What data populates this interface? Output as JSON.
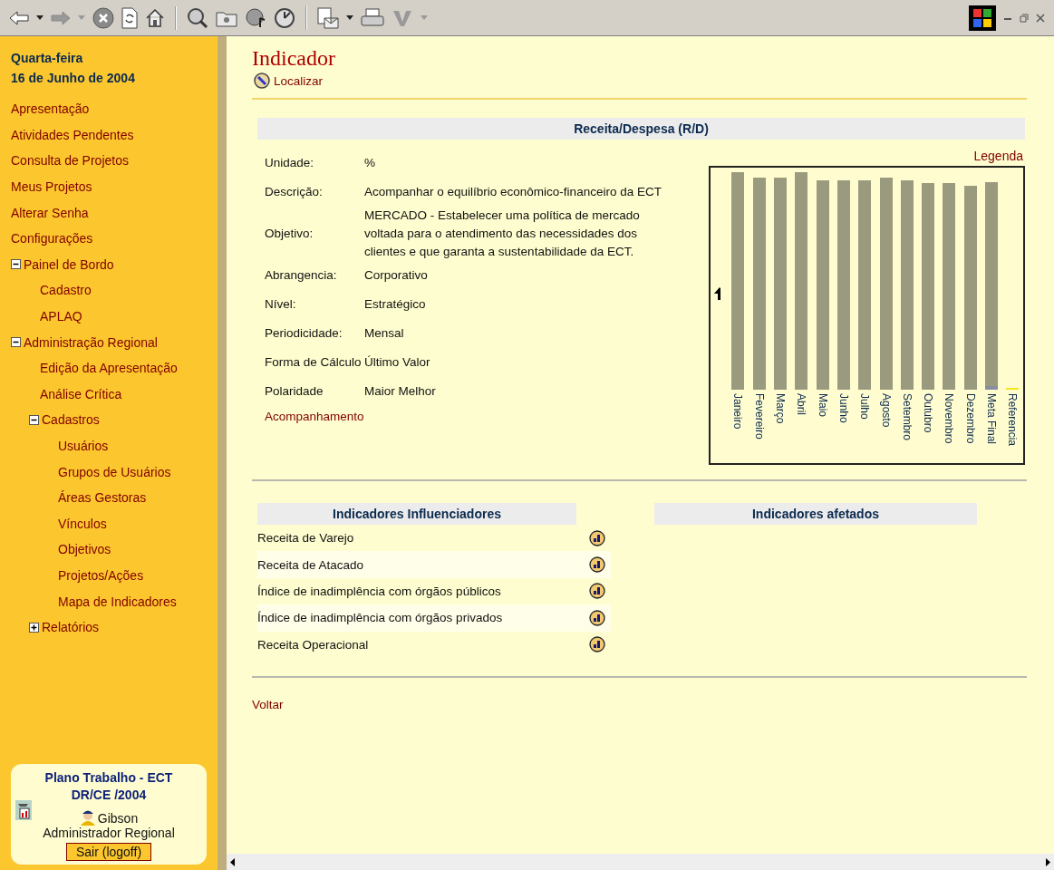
{
  "sidebar": {
    "date": [
      "Quarta-feira",
      "16 de Junho de 2004"
    ],
    "items": [
      {
        "label": "Apresentação"
      },
      {
        "label": "Atividades Pendentes"
      },
      {
        "label": "Consulta de Projetos"
      },
      {
        "label": "Meus Projetos"
      },
      {
        "label": "Alterar Senha"
      },
      {
        "label": "Configurações"
      },
      {
        "label": "Painel de Bordo",
        "expanded": true,
        "children": [
          {
            "label": "Cadastro"
          },
          {
            "label": "APLAQ"
          }
        ]
      },
      {
        "label": "Administração Regional",
        "expanded": true,
        "children": [
          {
            "label": "Edição da Apresentação"
          },
          {
            "label": "Análise Crítica"
          },
          {
            "label": "Cadastros",
            "expanded": true,
            "children": [
              {
                "label": "Usuários"
              },
              {
                "label": "Grupos de Usuários"
              },
              {
                "label": "Áreas Gestoras"
              },
              {
                "label": "Vínculos"
              },
              {
                "label": "Objetivos"
              },
              {
                "label": "Projetos/Ações"
              },
              {
                "label": "Mapa de Indicadores"
              }
            ]
          },
          {
            "label": "Relatórios",
            "expanded": false
          }
        ]
      }
    ]
  },
  "user_box": {
    "title": "Plano Trabalho - ECT",
    "subtitle": "DR/CE /2004",
    "user": "Gibson",
    "role": "Administrador Regional",
    "logout": "Sair (logoff)"
  },
  "page": {
    "title": "Indicador",
    "find_link": "Localizar",
    "section_title": "Receita/Despesa (R/D)",
    "fields": [
      {
        "label": "Unidade:",
        "value": "%"
      },
      {
        "label": "Descrição:",
        "value": "Acompanhar o equilíbrio econômico-financeiro da ECT"
      },
      {
        "label": "Objetivo:",
        "value": "MERCADO - Estabelecer uma política de mercado voltada para o atendimento das necessidades dos clientes e que garanta a sustentabilidade da ECT."
      },
      {
        "label": "Abrangencia:",
        "value": "Corporativo"
      },
      {
        "label": "Nível:",
        "value": "Estratégico"
      },
      {
        "label": "Periodicidade:",
        "value": "Mensal"
      },
      {
        "label": "Forma de Cálculo",
        "value": "Último Valor"
      },
      {
        "label": "Polaridade",
        "value": "Maior Melhor"
      }
    ],
    "follow_link": "Acompanhamento",
    "legend_link": "Legenda",
    "chart_labels": [
      {
        "label": "Janeiro",
        "kind": "bar"
      },
      {
        "label": "Fevereiro",
        "kind": "bar"
      },
      {
        "label": "Março",
        "kind": "bar"
      },
      {
        "label": "Abril",
        "kind": "bar"
      },
      {
        "label": "Maio",
        "kind": "bar"
      },
      {
        "label": "Junho",
        "kind": "bar"
      },
      {
        "label": "Julho",
        "kind": "bar"
      },
      {
        "label": "Agosto",
        "kind": "bar"
      },
      {
        "label": "Setembro",
        "kind": "bar"
      },
      {
        "label": "Outubro",
        "kind": "bar"
      },
      {
        "label": "Novembro",
        "kind": "bar"
      },
      {
        "label": "Dezembro",
        "kind": "bar"
      },
      {
        "label": "Meta Final",
        "kind": "target"
      },
      {
        "label": "Referencia",
        "kind": "reference"
      }
    ],
    "influencing": {
      "heading": "Indicadores Influenciadores",
      "rows": [
        {
          "label": "Receita de Varejo"
        },
        {
          "label": "Receita de Atacado"
        },
        {
          "label": "Índice de inadimplência com órgãos públicos"
        },
        {
          "label": "Índice de inadimplência com órgãos privados"
        },
        {
          "label": "Receita Operacional"
        }
      ]
    },
    "affected": {
      "heading": "Indicadores afetados"
    },
    "back_link": "Voltar"
  }
}
